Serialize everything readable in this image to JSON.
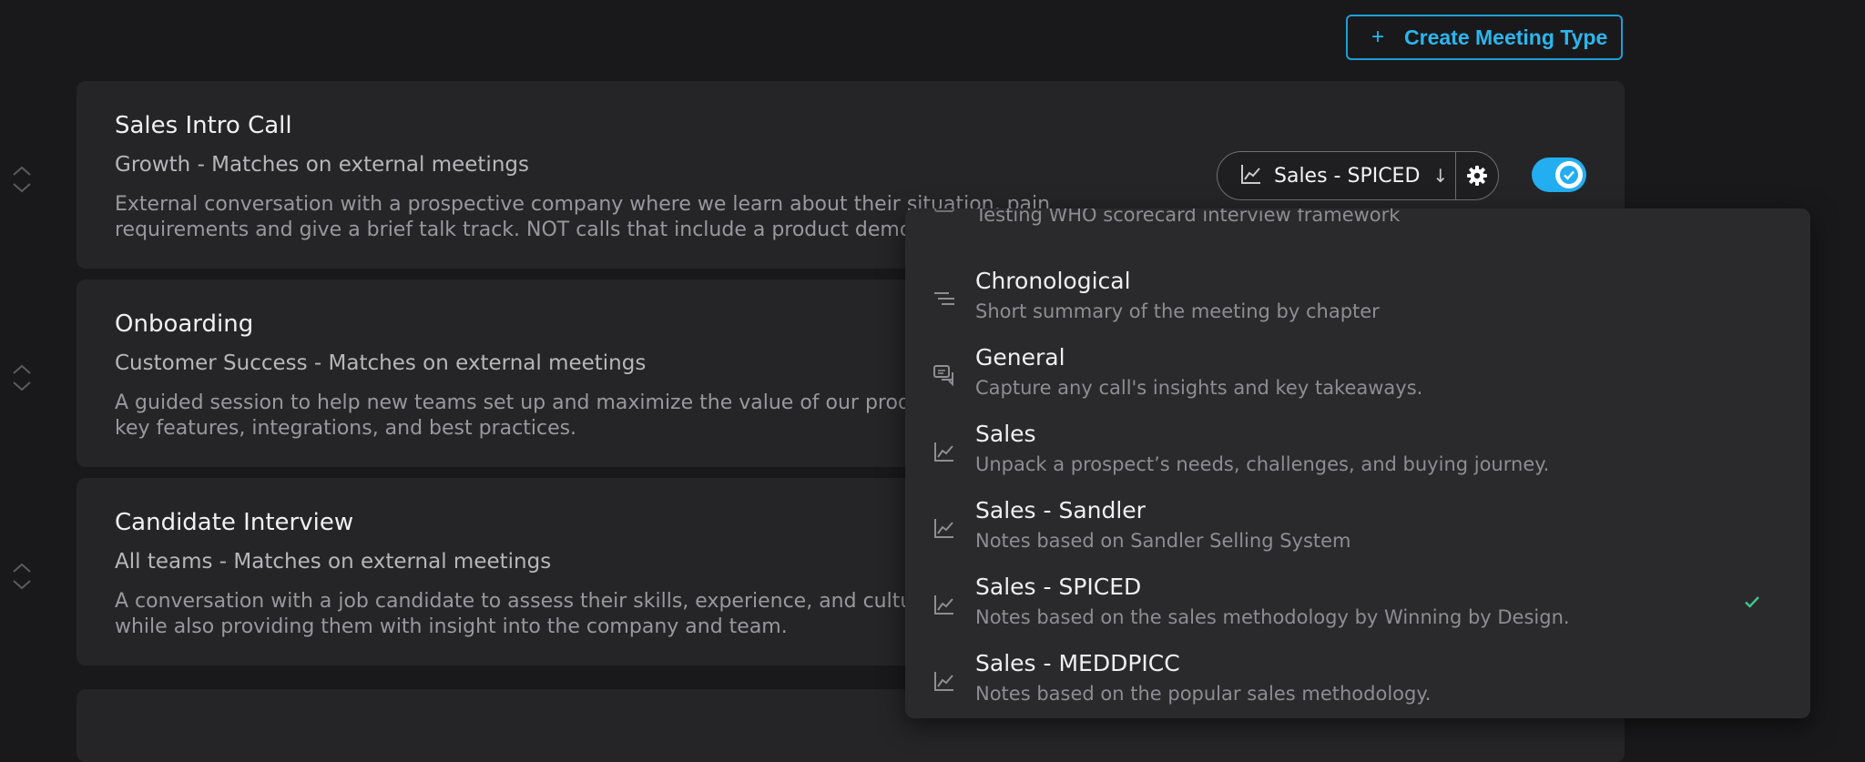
{
  "header": {
    "create_button_label": "Create Meeting Type"
  },
  "cards": [
    {
      "title": "Sales Intro Call",
      "subtitle": "Growth - Matches on external meetings",
      "desc_line1": "External conversation with a prospective company where we learn about their situation, pain",
      "desc_line2": "requirements and give a brief talk track. NOT calls that include a product demo"
    },
    {
      "title": "Onboarding",
      "subtitle": "Customer Success - Matches on external meetings",
      "desc_line1": "A guided session to help new teams set up and maximize the value of our product",
      "desc_line2": "key features, integrations, and best practices."
    },
    {
      "title": "Candidate Interview",
      "subtitle": "All teams - Matches on external meetings",
      "desc_line1": "A conversation with a job candidate to assess their skills, experience, and culture fit",
      "desc_line2": "while also providing them with insight into the company and team."
    }
  ],
  "template_select": {
    "selected_label": "Sales - SPICED",
    "icon": "chart-line-icon",
    "arrow": "↓"
  },
  "toggle": {
    "enabled": true,
    "accent_color": "#22aef0"
  },
  "dropdown": {
    "options": [
      {
        "title": "",
        "desc": "Testing WHO scorecard interview framework",
        "icon": "list-icon",
        "selected": false
      },
      {
        "title": "Chronological",
        "desc": "Short summary of the meeting by chapter",
        "icon": "chronological-icon",
        "selected": false
      },
      {
        "title": "General",
        "desc": "Capture any call's insights and key takeaways.",
        "icon": "chat-bubbles-icon",
        "selected": false
      },
      {
        "title": "Sales",
        "desc": "Unpack a prospect’s needs, challenges, and buying journey.",
        "icon": "chart-line-icon",
        "selected": false
      },
      {
        "title": "Sales - Sandler",
        "desc": "Notes based on Sandler Selling System",
        "icon": "chart-line-icon",
        "selected": false
      },
      {
        "title": "Sales - SPICED",
        "desc": "Notes based on the sales methodology by Winning by Design.",
        "icon": "chart-line-icon",
        "selected": true
      },
      {
        "title": "Sales - MEDDPICC",
        "desc": "Notes based on the popular sales methodology.",
        "icon": "chart-line-icon",
        "selected": false
      }
    ],
    "check_color": "#3fc68b"
  }
}
